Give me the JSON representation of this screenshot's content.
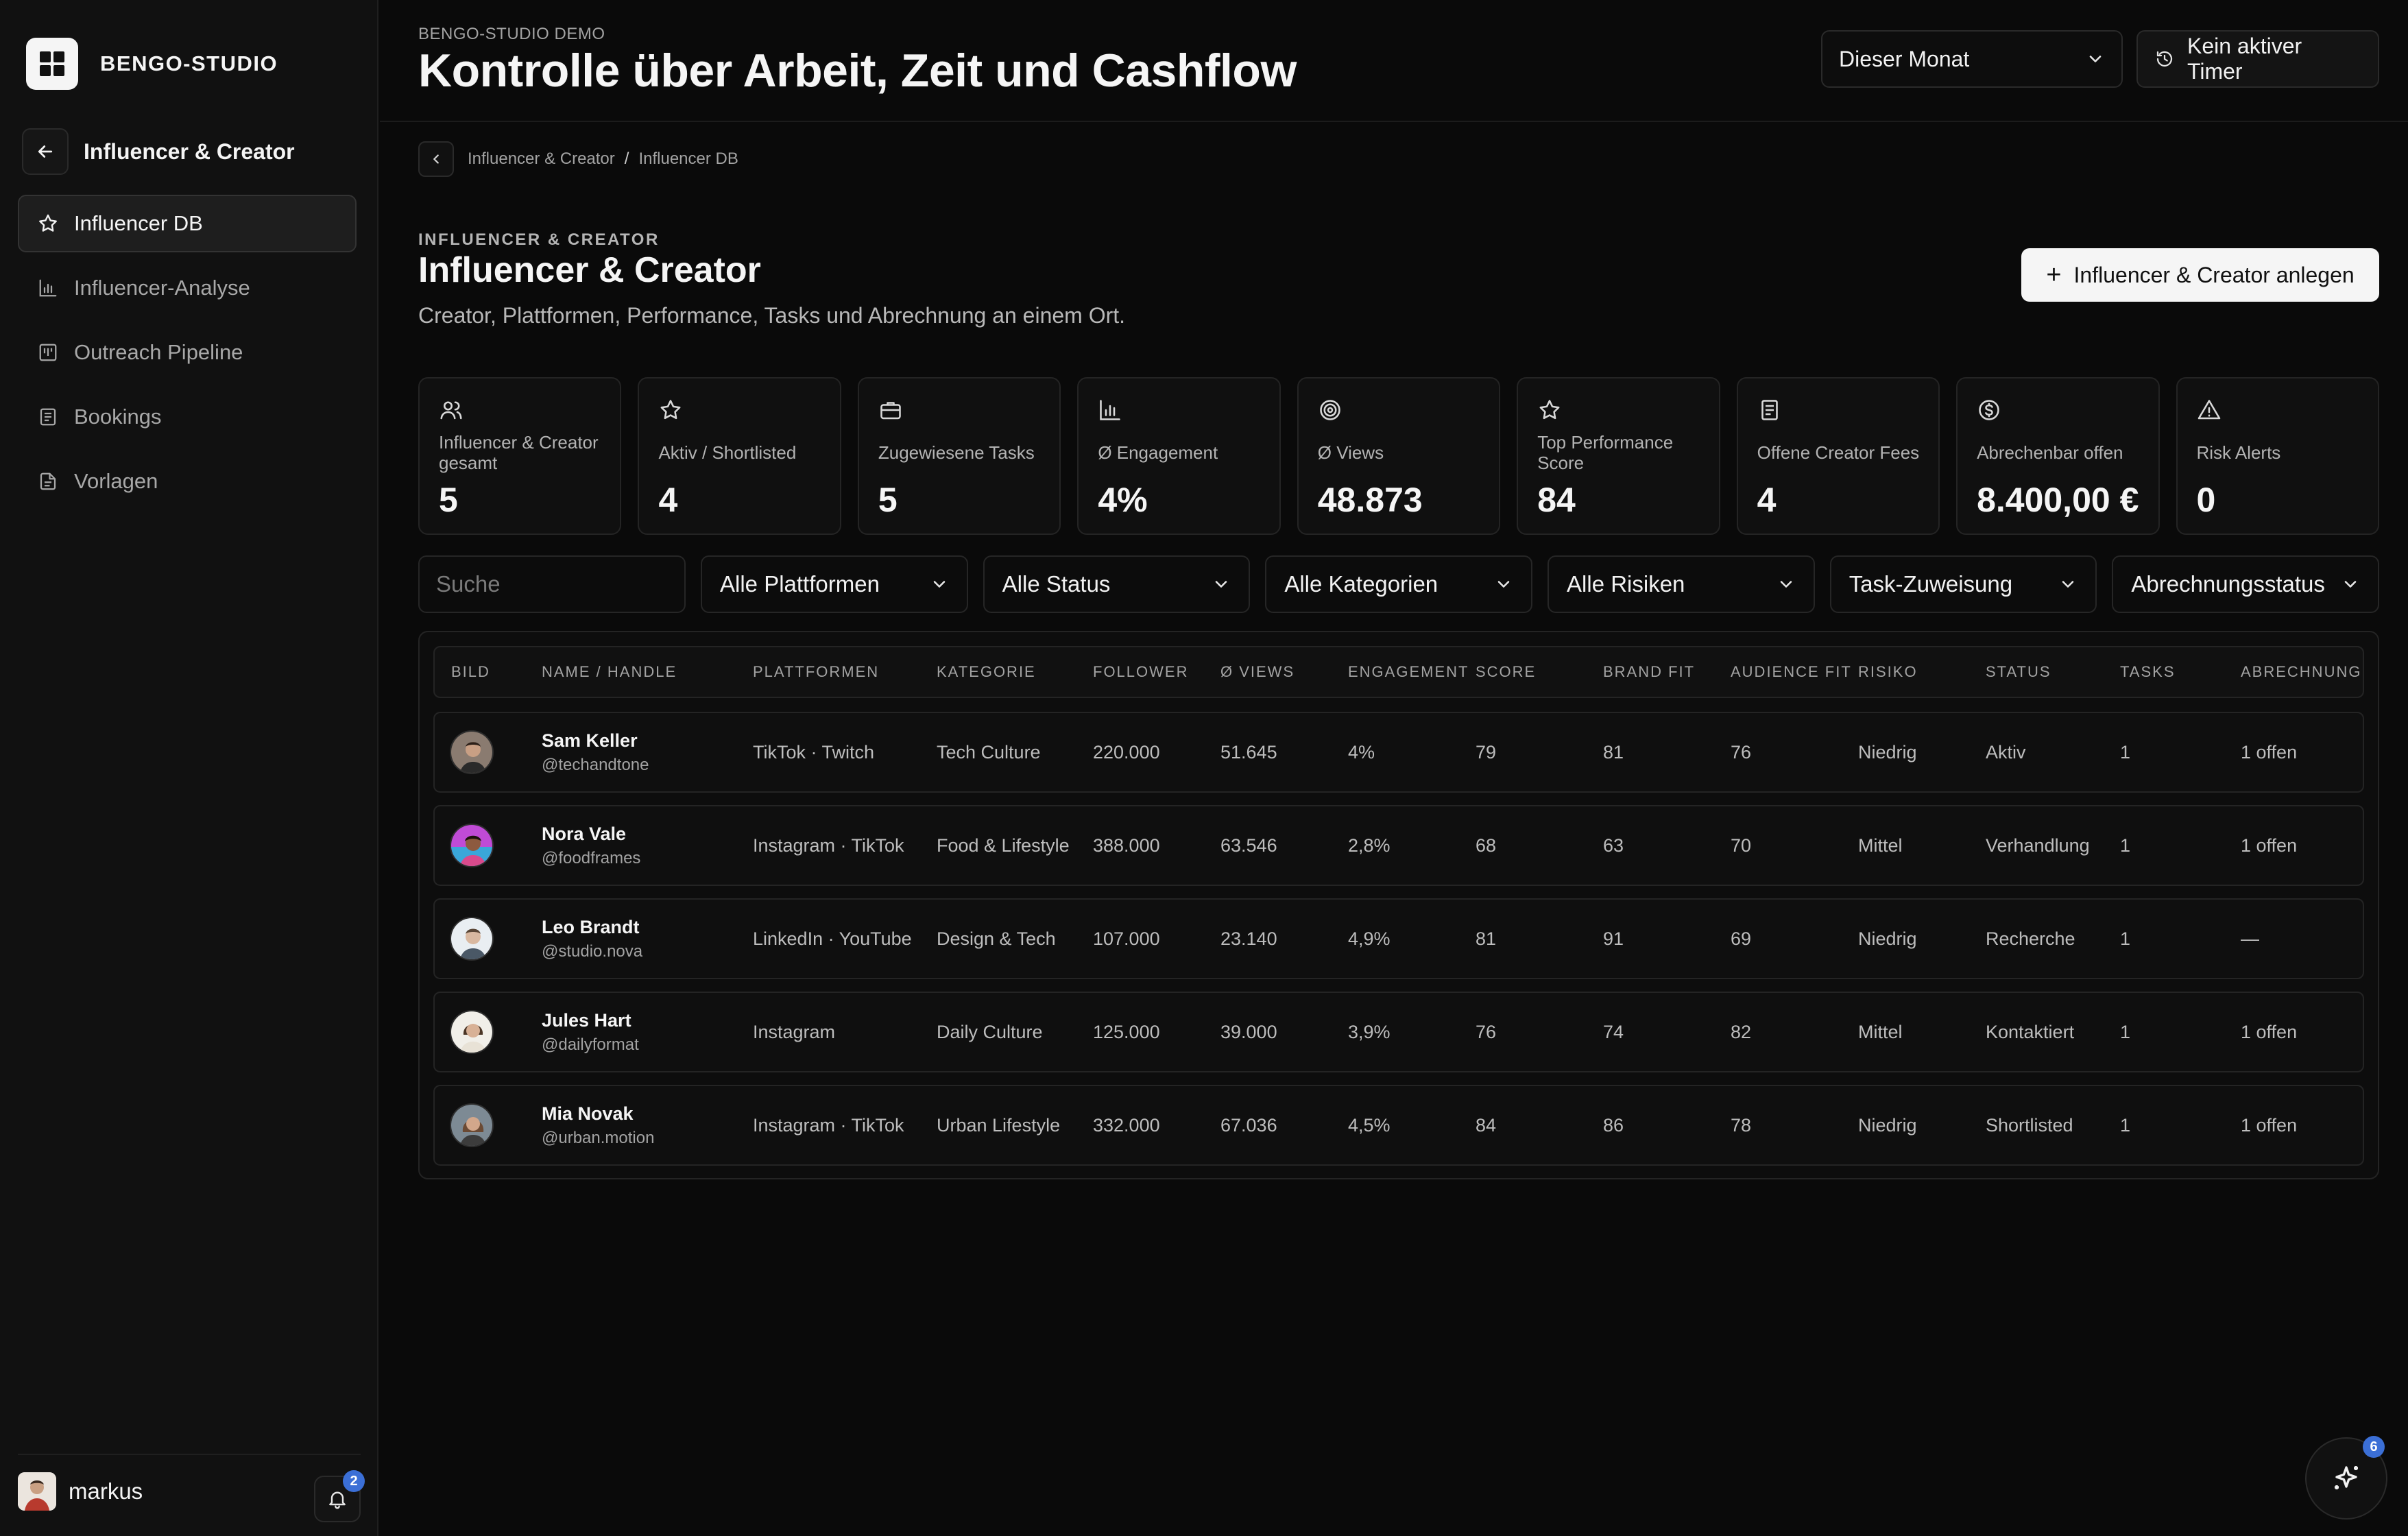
{
  "app": {
    "brand": "BENGO-STUDIO"
  },
  "sidebar": {
    "section_title": "Influencer & Creator",
    "items": [
      {
        "label": "Influencer DB",
        "icon": "star-icon",
        "active": true
      },
      {
        "label": "Influencer-Analyse",
        "icon": "bar-chart-icon",
        "active": false
      },
      {
        "label": "Outreach Pipeline",
        "icon": "kanban-icon",
        "active": false
      },
      {
        "label": "Bookings",
        "icon": "document-icon",
        "active": false
      },
      {
        "label": "Vorlagen",
        "icon": "file-icon",
        "active": false
      }
    ],
    "user": {
      "name": "markus",
      "notifications": "2"
    }
  },
  "header": {
    "overline": "BENGO-STUDIO DEMO",
    "title": "Kontrolle über Arbeit, Zeit und Cashflow",
    "period": "Dieser Monat",
    "timer": "Kein aktiver Timer"
  },
  "breadcrumb": {
    "parent": "Influencer & Creator",
    "separator": "/",
    "current": "Influencer DB"
  },
  "section": {
    "overline": "INFLUENCER & CREATOR",
    "title": "Influencer & Creator",
    "subtitle": "Creator, Plattformen, Performance, Tasks und Abrechnung an einem Ort.",
    "add_button": "Influencer & Creator anlegen"
  },
  "kpis": [
    {
      "icon": "users-icon",
      "label": "Influencer & Creator gesamt",
      "value": "5"
    },
    {
      "icon": "star-icon",
      "label": "Aktiv / Shortlisted",
      "value": "4"
    },
    {
      "icon": "briefcase-icon",
      "label": "Zugewiesene Tasks",
      "value": "5"
    },
    {
      "icon": "bar-chart-icon",
      "label": "Ø Engagement",
      "value": "4%"
    },
    {
      "icon": "target-icon",
      "label": "Ø Views",
      "value": "48.873"
    },
    {
      "icon": "star-icon",
      "label": "Top Performance Score",
      "value": "84"
    },
    {
      "icon": "receipt-icon",
      "label": "Offene Creator Fees",
      "value": "4"
    },
    {
      "icon": "dollar-icon",
      "label": "Abrechenbar offen",
      "value": "8.400,00 €"
    },
    {
      "icon": "alert-icon",
      "label": "Risk Alerts",
      "value": "0"
    }
  ],
  "filters": {
    "search_placeholder": "Suche",
    "selects": [
      "Alle Plattformen",
      "Alle Status",
      "Alle Kategorien",
      "Alle Risiken",
      "Task-Zuweisung",
      "Abrechnungsstatus"
    ]
  },
  "table": {
    "columns": [
      "Bild",
      "Name / Handle",
      "Plattformen",
      "Kategorie",
      "Follower",
      "Ø Views",
      "Engagement",
      "Score",
      "Brand Fit",
      "Audience Fit",
      "Risiko",
      "Status",
      "Tasks",
      "Abrechnung"
    ],
    "rows": [
      {
        "name": "Sam Keller",
        "handle": "@techandtone",
        "platforms": "TikTok · Twitch",
        "category": "Tech Culture",
        "followers": "220.000",
        "views": "51.645",
        "engagement": "4%",
        "score": "79",
        "brand_fit": "81",
        "audience_fit": "76",
        "risk": "Niedrig",
        "status": "Aktiv",
        "tasks": "1",
        "billing": "1 offen",
        "avatar_bg": "#8a7b70",
        "avatar_skin": "#c89f84"
      },
      {
        "name": "Nora Vale",
        "handle": "@foodframes",
        "platforms": "Instagram · TikTok",
        "category": "Food & Lifestyle",
        "followers": "388.000",
        "views": "63.546",
        "engagement": "2,8%",
        "score": "68",
        "brand_fit": "63",
        "audience_fit": "70",
        "risk": "Mittel",
        "status": "Verhandlung",
        "tasks": "1",
        "billing": "1 offen",
        "avatar_bg": "#c04bd6",
        "avatar_skin": "#8d5a3f"
      },
      {
        "name": "Leo Brandt",
        "handle": "@studio.nova",
        "platforms": "LinkedIn · YouTube",
        "category": "Design & Tech",
        "followers": "107.000",
        "views": "23.140",
        "engagement": "4,9%",
        "score": "81",
        "brand_fit": "91",
        "audience_fit": "69",
        "risk": "Niedrig",
        "status": "Recherche",
        "tasks": "1",
        "billing": "—",
        "avatar_bg": "#e9eef2",
        "avatar_skin": "#d9b8a0"
      },
      {
        "name": "Jules Hart",
        "handle": "@dailyformat",
        "platforms": "Instagram",
        "category": "Daily Culture",
        "followers": "125.000",
        "views": "39.000",
        "engagement": "3,9%",
        "score": "76",
        "brand_fit": "74",
        "audience_fit": "82",
        "risk": "Mittel",
        "status": "Kontaktiert",
        "tasks": "1",
        "billing": "1 offen",
        "avatar_bg": "#f1efe9",
        "avatar_skin": "#d8b196"
      },
      {
        "name": "Mia Novak",
        "handle": "@urban.motion",
        "platforms": "Instagram · TikTok",
        "category": "Urban Lifestyle",
        "followers": "332.000",
        "views": "67.036",
        "engagement": "4,5%",
        "score": "84",
        "brand_fit": "86",
        "audience_fit": "78",
        "risk": "Niedrig",
        "status": "Shortlisted",
        "tasks": "1",
        "billing": "1 offen",
        "avatar_bg": "#7d8a94",
        "avatar_skin": "#d2a78b"
      }
    ]
  },
  "assistant": {
    "badge": "6"
  },
  "colors": {
    "background": "#0a0a0a",
    "sidebar": "#111111",
    "accent": "#3b6fd6",
    "card_border": "#242424"
  }
}
